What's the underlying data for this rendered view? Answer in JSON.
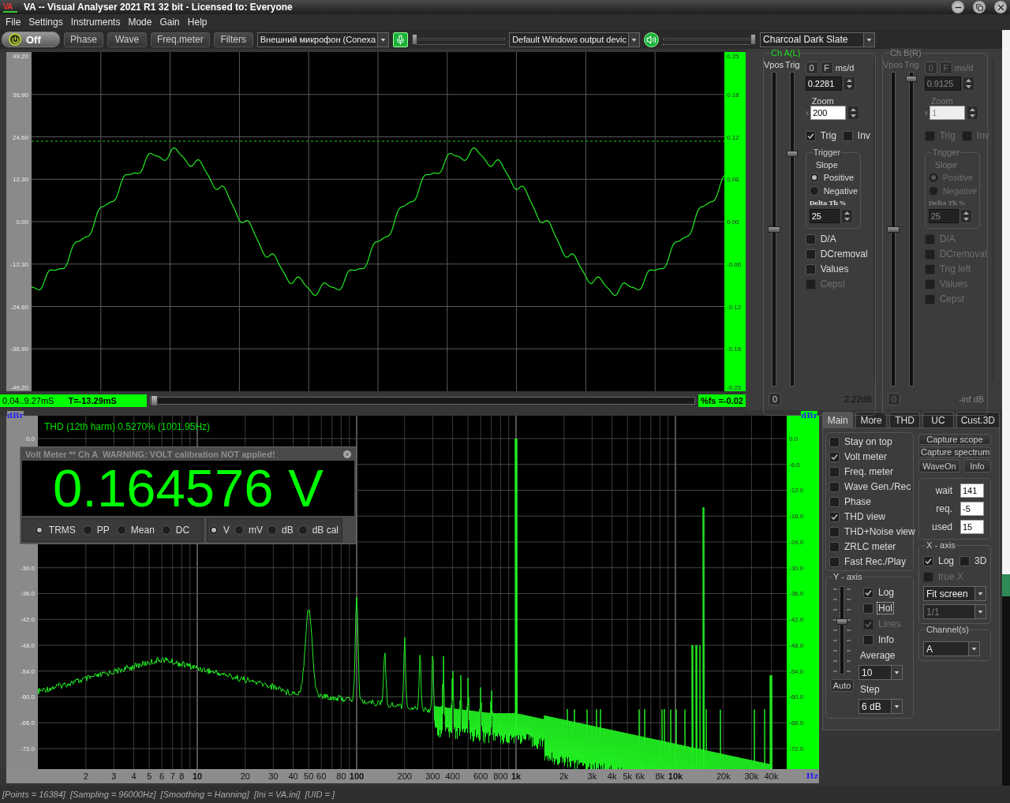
{
  "window": {
    "logo": "VA",
    "title": "VA -- Visual Analyser 2021 R1 32 bit - Licensed to: Everyone"
  },
  "menu": [
    "File",
    "Settings",
    "Instruments",
    "Mode",
    "Gain",
    "Help"
  ],
  "toolbar": {
    "power_label": "Off",
    "buttons": [
      "Phase",
      "Wave",
      "Freq.meter",
      "Filters"
    ],
    "input_device": "Внешний микрофон (Conexa",
    "input_slider": {
      "level": 0.0
    },
    "output_device": "Default Windows output devic",
    "output_slider": {
      "level": 1.0
    },
    "theme": "Charcoal Dark Slate"
  },
  "scope": {
    "left_ticks": [
      "49.20",
      "36.90",
      "24.60",
      "12.30",
      "0.00",
      "-12.30",
      "-24.60",
      "-36.90",
      "-49.20"
    ],
    "right_ticks": [
      "0.25",
      "0.18",
      "0.12",
      "0.06",
      "0.00",
      "-0.06",
      "-0.12",
      "-0.18",
      "-0.25"
    ],
    "time_range": "0.04..9.27mS",
    "time_cursor": "T=-13.29mS",
    "position_slider": {
      "level": 0.0
    },
    "fs_reading": "%fs =-0.02"
  },
  "channels": [
    {
      "title": "Ch A(L)",
      "disabled": false,
      "vpos": {
        "label": "Vpos",
        "level": 0.5
      },
      "trig_slider": {
        "label": "Trig",
        "level": 0.74
      },
      "zero_button": "0",
      "f_button": "F",
      "ms_label": "ms/d",
      "ms_value": "0.2281",
      "zoom_label": "Zoom",
      "zoom_prefix": "x",
      "zoom_value": "200",
      "trig": {
        "label": "Trig",
        "checked": true
      },
      "inv": {
        "label": "Inv",
        "checked": false
      },
      "trigger_title": "Trigger",
      "slope_title": "Slope",
      "slopes": [
        {
          "label": "Positive",
          "selected": true
        },
        {
          "label": "Negative",
          "selected": false
        }
      ],
      "delta_label": "Delta Th %",
      "delta_value": "25",
      "options": [
        {
          "label": "D/A",
          "checked": false,
          "disabled": false
        },
        {
          "label": "DCremoval",
          "checked": false,
          "disabled": false
        },
        {
          "label": "Values",
          "checked": false,
          "disabled": false
        },
        {
          "label": "Cepst",
          "checked": false,
          "disabled": true
        }
      ],
      "offset_button": "0",
      "reading": "2.22dB"
    },
    {
      "title": "Ch B(R)",
      "disabled": true,
      "vpos": {
        "label": "Vpos",
        "level": 0.5
      },
      "trig_slider": {
        "label": "Trig",
        "level": 0.98
      },
      "zero_button": "0",
      "f_button": "F",
      "ms_label": "ms/d",
      "ms_value": "0.9125",
      "zoom_label": "Zoom",
      "zoom_prefix": "x",
      "zoom_value": "1",
      "trig": {
        "label": "Trig",
        "checked": false
      },
      "inv": {
        "label": "Inv",
        "checked": false
      },
      "trigger_title": "Trigger",
      "slope_title": "Slope",
      "slopes": [
        {
          "label": "Positive",
          "selected": true
        },
        {
          "label": "Negative",
          "selected": false
        }
      ],
      "delta_label": "Delta Th %",
      "delta_value": "25",
      "options": [
        {
          "label": "D/A",
          "checked": false,
          "disabled": true
        },
        {
          "label": "DCremoval",
          "checked": false,
          "disabled": true
        },
        {
          "label": "Trig left",
          "checked": false,
          "disabled": true
        },
        {
          "label": "Values",
          "checked": false,
          "disabled": true
        },
        {
          "label": "Cepst",
          "checked": false,
          "disabled": true
        }
      ],
      "offset_button": "0",
      "reading": "-inf dB"
    }
  ],
  "spectrum": {
    "thd_text": "THD (12th harm) 0.5270% (1001.95Hz)",
    "unit_left": "dBr",
    "unit_right": "dBr",
    "left_ticks": [
      "0.0",
      "-30.0",
      "-36.0",
      "-42.0",
      "-48.0",
      "-54.0",
      "-60.0",
      "-66.0",
      "-72.0"
    ],
    "right_ticks": [
      "0.0",
      "-6.0",
      "-12.0",
      "-18.0",
      "-24.0",
      "-30.0",
      "-36.0",
      "-42.0",
      "-48.0",
      "-54.0",
      "-60.0",
      "-66.0",
      "-72.0"
    ],
    "x_ticks": [
      {
        "label": "2",
        "major": false
      },
      {
        "label": "3",
        "major": false
      },
      {
        "label": "4",
        "major": false
      },
      {
        "label": "5",
        "major": false
      },
      {
        "label": "6",
        "major": false
      },
      {
        "label": "7",
        "major": false
      },
      {
        "label": "8",
        "major": false
      },
      {
        "label": "10",
        "major": true
      },
      {
        "label": "20",
        "major": false
      },
      {
        "label": "30",
        "major": false
      },
      {
        "label": "40",
        "major": false
      },
      {
        "label": "50",
        "major": false
      },
      {
        "label": "60",
        "major": false
      },
      {
        "label": "80",
        "major": false
      },
      {
        "label": "100",
        "major": true
      },
      {
        "label": "200",
        "major": false
      },
      {
        "label": "300",
        "major": false
      },
      {
        "label": "400",
        "major": false
      },
      {
        "label": "600",
        "major": false
      },
      {
        "label": "800",
        "major": false
      },
      {
        "label": "1k",
        "major": true
      },
      {
        "label": "2k",
        "major": false
      },
      {
        "label": "3k",
        "major": false
      },
      {
        "label": "4k",
        "major": false
      },
      {
        "label": "5k",
        "major": false
      },
      {
        "label": "6k",
        "major": false
      },
      {
        "label": "8k",
        "major": false
      },
      {
        "label": "10k",
        "major": true
      },
      {
        "label": "20k",
        "major": false
      },
      {
        "label": "30k",
        "major": false
      },
      {
        "label": "40k",
        "major": false
      }
    ],
    "x_unit": "Hz"
  },
  "volt_meter": {
    "title": "Volt Meter ** Ch A  WARNING: VOLT calibration NOT applied!",
    "reading": "0.164576 V",
    "modes": [
      {
        "label": "TRMS",
        "selected": true
      },
      {
        "label": "PP",
        "selected": false
      },
      {
        "label": "Mean",
        "selected": false
      },
      {
        "label": "DC",
        "selected": false
      }
    ],
    "units": [
      {
        "label": "V",
        "selected": true
      },
      {
        "label": "mV",
        "selected": false
      },
      {
        "label": "dB",
        "selected": false
      },
      {
        "label": "dB cal",
        "selected": false
      }
    ]
  },
  "control_panel": {
    "tabs": [
      {
        "label": "Main",
        "selected": true
      },
      {
        "label": "More",
        "selected": false
      },
      {
        "label": "THD",
        "selected": false
      },
      {
        "label": "UC",
        "selected": false
      },
      {
        "label": "Cust.3D",
        "selected": false
      }
    ],
    "options": [
      {
        "label": "Stay on top",
        "checked": false
      },
      {
        "label": "Volt meter",
        "checked": true
      },
      {
        "label": "Freq. meter",
        "checked": false
      },
      {
        "label": "Wave Gen./Rec",
        "checked": false
      },
      {
        "label": "Phase",
        "checked": false
      },
      {
        "label": "THD view",
        "checked": true
      },
      {
        "label": "THD+Noise view",
        "checked": false
      },
      {
        "label": "ZRLC meter",
        "checked": false
      },
      {
        "label": "Fast Rec./Play",
        "checked": false
      }
    ],
    "buttons": [
      "Capture scope",
      "Capture spectrum"
    ],
    "small_buttons": [
      "WaveOn",
      "Info"
    ],
    "timing": [
      {
        "label": "wait",
        "value": "141"
      },
      {
        "label": "req.",
        "value": "-5"
      },
      {
        "label": "used",
        "value": "15"
      }
    ],
    "y_axis": {
      "title": "Y - axis",
      "slider": {
        "level": 0.6
      },
      "auto_button": "Auto",
      "options": [
        {
          "label": "Log",
          "checked": true,
          "disabled": false,
          "focused": false
        },
        {
          "label": "Hol",
          "checked": false,
          "disabled": false,
          "focused": true
        },
        {
          "label": "Lines",
          "checked": true,
          "disabled": true,
          "focused": false
        },
        {
          "label": "Info",
          "checked": false,
          "disabled": false,
          "focused": false
        }
      ],
      "average_label": "Average",
      "average_value": "10",
      "step_label": "Step",
      "step_value": "6 dB"
    },
    "x_axis": {
      "title": "X - axis",
      "options": [
        {
          "label": "Log",
          "checked": true,
          "disabled": false
        },
        {
          "label": "3D",
          "checked": false,
          "disabled": false
        },
        {
          "label": "true X",
          "checked": false,
          "disabled": true
        }
      ],
      "scale": "Fit screen",
      "ratio": {
        "value": "1/1",
        "disabled": true
      }
    },
    "channel_select": {
      "title": "Channel(s)",
      "value": "A"
    }
  },
  "status_bar": "[Points = 16384]  [Sampling = 96000Hz]  [Smoothing = Hanning]  [Ini = VA.ini]  [UID = ]"
}
